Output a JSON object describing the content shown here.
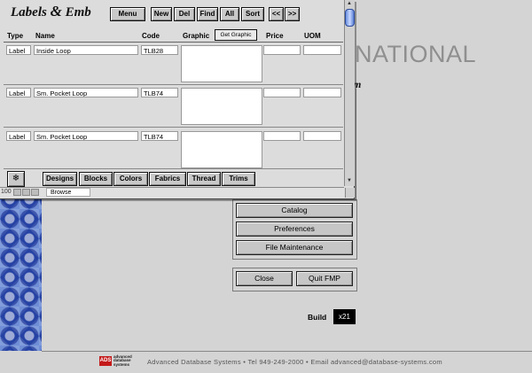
{
  "background": {
    "brand_fragment": "NATIONAL",
    "script_fragment": "m",
    "buttons": {
      "catalog": "Catalog",
      "preferences": "Preferences",
      "file_maintenance": "File Maintenance",
      "close": "Close",
      "quit": "Quit FMP"
    },
    "build_label": "Build",
    "build_value": "x21",
    "footer_logo_mark": "ADS",
    "footer_logo_words": "advanced database systems",
    "footer_text": "Advanced Database Systems • Tel 949-249-2000 • Email advanced@database-systems.com"
  },
  "window": {
    "title_part1": "Labels ",
    "title_amp": "&",
    "title_part2": " Emb",
    "toolbar": [
      "Menu",
      "New",
      "Del",
      "Find",
      "All",
      "Sort",
      "<<",
      ">>"
    ],
    "columns": {
      "type": "Type",
      "name": "Name",
      "code": "Code",
      "graphic": "Graphic",
      "get_graphic": "Get Graphic",
      "price": "Price",
      "uom": "UOM"
    },
    "records": [
      {
        "type": "Label",
        "name": "Inside Loop",
        "code": "TLB28",
        "price": "",
        "uom": ""
      },
      {
        "type": "Label",
        "name": "Sm. Pocket Loop",
        "code": "TLB74",
        "price": "",
        "uom": ""
      },
      {
        "type": "Label",
        "name": "Sm. Pocket Loop",
        "code": "TLB74",
        "price": "",
        "uom": ""
      }
    ],
    "nav_buttons": [
      "Designs",
      "Blocks",
      "Colors",
      "Fabrics",
      "Thread",
      "Trims"
    ],
    "status": {
      "zoom": "100",
      "mode": "Browse"
    }
  },
  "colors": {
    "background": "#d4d4d4",
    "window": "#dcdcdc",
    "accent_blue": "#3f68c8",
    "logo_red": "#c41a1a"
  }
}
